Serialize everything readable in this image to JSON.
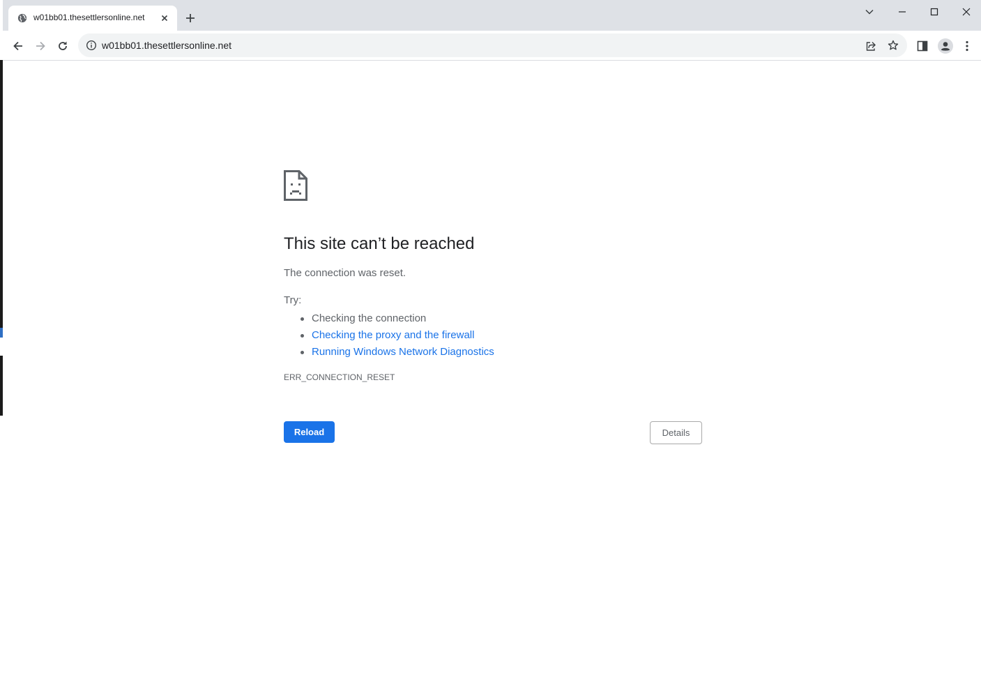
{
  "browser": {
    "tab": {
      "title": "w01bb01.thesettlersonline.net",
      "favicon": "globe-icon"
    },
    "address_bar": {
      "url": "w01bb01.thesettlersonline.net",
      "security_icon": "info-icon"
    },
    "toolbar_icons": [
      "back-icon",
      "forward-icon",
      "reload-icon",
      "share-icon",
      "star-icon",
      "side-panel-icon",
      "profile-icon",
      "menu-icon"
    ],
    "window_controls": [
      "tab-search-icon",
      "minimize-icon",
      "maximize-icon",
      "close-icon"
    ]
  },
  "error_page": {
    "icon": "sad-page-icon",
    "heading": "This site can’t be reached",
    "description": "The connection was reset.",
    "try_label": "Try:",
    "suggestions": [
      {
        "text": "Checking the connection",
        "is_link": false
      },
      {
        "text": "Checking the proxy and the firewall",
        "is_link": true
      },
      {
        "text": "Running Windows Network Diagnostics",
        "is_link": true
      }
    ],
    "error_code": "ERR_CONNECTION_RESET",
    "reload_label": "Reload",
    "details_label": "Details"
  },
  "colors": {
    "tabstrip_bg": "#dee1e6",
    "omnibox_bg": "#f1f3f4",
    "primary_button": "#1a73e8",
    "link": "#1a73e8",
    "secondary_text": "#5f6368",
    "heading_text": "#202124"
  }
}
